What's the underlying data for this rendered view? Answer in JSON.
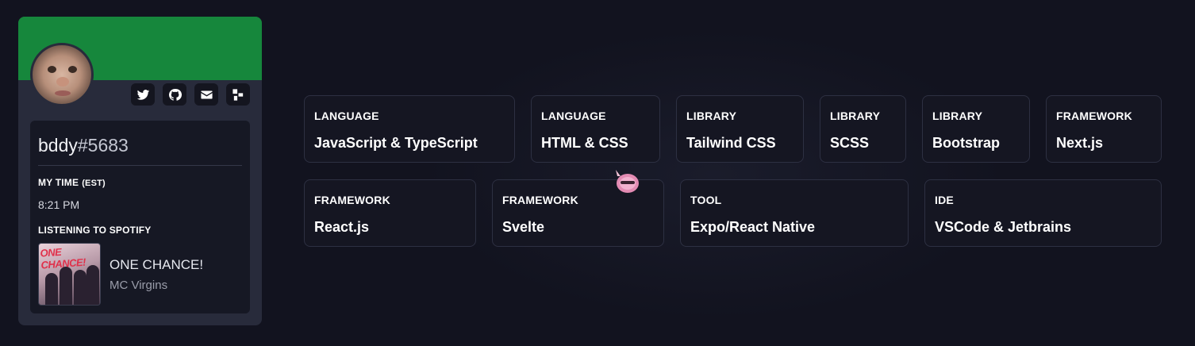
{
  "profile": {
    "banner_color": "#16873c",
    "username": "bddy",
    "discriminator": "#5683",
    "socials": [
      {
        "icon": "twitter-icon"
      },
      {
        "icon": "github-icon"
      },
      {
        "icon": "mail-icon"
      },
      {
        "icon": "website-icon"
      }
    ],
    "time_label": "MY TIME",
    "time_zone": "(EST)",
    "time_value": "8:21 PM",
    "spotify_label": "LISTENING TO SPOTIFY",
    "track": {
      "album_art_text": "ONE CHANCE!",
      "title": "ONE CHANCE!",
      "artist": "MC Virgins"
    }
  },
  "tech_stack": [
    {
      "category": "LANGUAGE",
      "name": "JavaScript & TypeScript"
    },
    {
      "category": "LANGUAGE",
      "name": "HTML & CSS"
    },
    {
      "category": "LIBRARY",
      "name": "Tailwind CSS"
    },
    {
      "category": "LIBRARY",
      "name": "SCSS"
    },
    {
      "category": "LIBRARY",
      "name": "Bootstrap"
    },
    {
      "category": "FRAMEWORK",
      "name": "Next.js"
    },
    {
      "category": "FRAMEWORK",
      "name": "React.js"
    },
    {
      "category": "FRAMEWORK",
      "name": "Svelte"
    },
    {
      "category": "TOOL",
      "name": "Expo/React Native"
    },
    {
      "category": "IDE",
      "name": "VSCode & Jetbrains"
    }
  ]
}
